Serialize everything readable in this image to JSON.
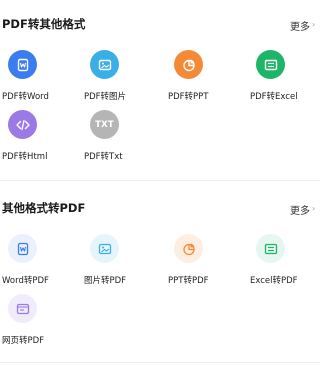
{
  "section1": {
    "title": "PDF转其他格式",
    "more_label": "更多",
    "items": [
      {
        "label": "PDF转Word",
        "icon": "word-doc-icon",
        "color": "#3b7cf0"
      },
      {
        "label": "PDF转图片",
        "icon": "image-icon",
        "color": "#3aaee6"
      },
      {
        "label": "PDF转PPT",
        "icon": "pie-chart-icon",
        "color": "#f58a36"
      },
      {
        "label": "PDF转Excel",
        "icon": "spreadsheet-icon",
        "color": "#1db567"
      },
      {
        "label": "PDF转Html",
        "icon": "code-icon",
        "color": "#9b7ae6"
      },
      {
        "label": "PDF转Txt",
        "icon": "txt-icon",
        "glyph": "TXT",
        "color": "#b5b5b5"
      }
    ]
  },
  "section2": {
    "title": "其他格式转PDF",
    "more_label": "更多",
    "items": [
      {
        "label": "Word转PDF",
        "icon": "word-doc-icon",
        "color": "#eaf1fd",
        "fg": "#3b7cf0"
      },
      {
        "label": "图片转PDF",
        "icon": "image-icon",
        "color": "#e6f5fb",
        "fg": "#3aaee6"
      },
      {
        "label": "PPT转PDF",
        "icon": "pie-chart-icon",
        "color": "#fdeee2",
        "fg": "#f58a36"
      },
      {
        "label": "Excel转PDF",
        "icon": "spreadsheet-icon",
        "color": "#e5f7ee",
        "fg": "#1db567"
      },
      {
        "label": "网页转PDF",
        "icon": "browser-icon",
        "color": "#f1ecfb",
        "fg": "#9b7ae6"
      }
    ]
  }
}
